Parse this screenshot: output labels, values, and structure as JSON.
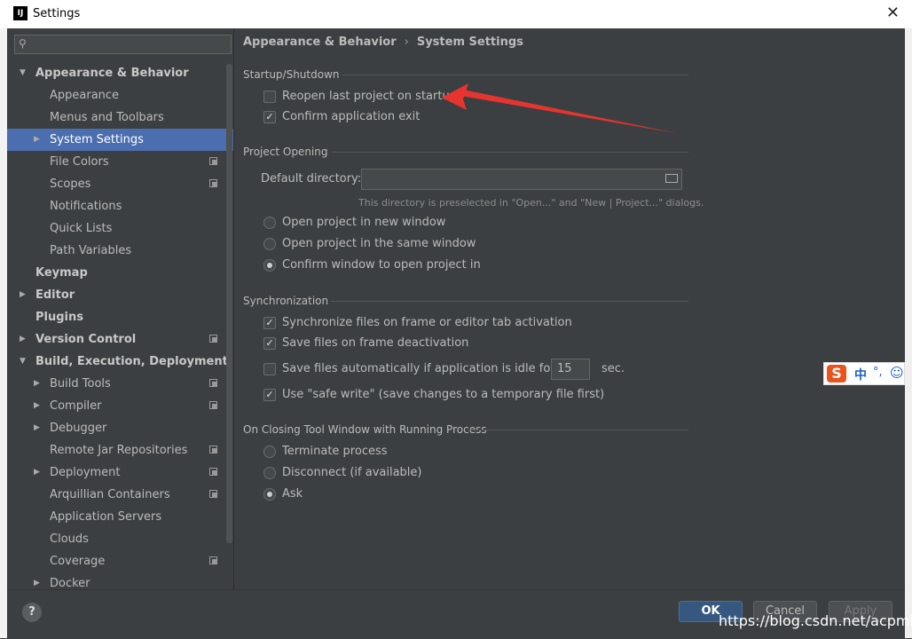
{
  "window": {
    "title": "Settings",
    "app_icon": "IJ"
  },
  "search": {
    "placeholder": ""
  },
  "sidebar": {
    "items": [
      {
        "label": "Appearance & Behavior",
        "level": 0,
        "arrow": "down",
        "bold": true
      },
      {
        "label": "Appearance",
        "level": 1
      },
      {
        "label": "Menus and Toolbars",
        "level": 1
      },
      {
        "label": "System Settings",
        "level": 1,
        "arrow": "right",
        "selected": true
      },
      {
        "label": "File Colors",
        "level": 1,
        "copy": true
      },
      {
        "label": "Scopes",
        "level": 1,
        "copy": true
      },
      {
        "label": "Notifications",
        "level": 1
      },
      {
        "label": "Quick Lists",
        "level": 1
      },
      {
        "label": "Path Variables",
        "level": 1
      },
      {
        "label": "Keymap",
        "level": 0,
        "bold": true
      },
      {
        "label": "Editor",
        "level": 0,
        "arrow": "right",
        "bold": true
      },
      {
        "label": "Plugins",
        "level": 0,
        "bold": true
      },
      {
        "label": "Version Control",
        "level": 0,
        "arrow": "right",
        "bold": true,
        "copy": true
      },
      {
        "label": "Build, Execution, Deployment",
        "level": 0,
        "arrow": "down",
        "bold": true
      },
      {
        "label": "Build Tools",
        "level": 1,
        "arrow": "right",
        "copy": true
      },
      {
        "label": "Compiler",
        "level": 1,
        "arrow": "right",
        "copy": true
      },
      {
        "label": "Debugger",
        "level": 1,
        "arrow": "right"
      },
      {
        "label": "Remote Jar Repositories",
        "level": 1,
        "copy": true
      },
      {
        "label": "Deployment",
        "level": 1,
        "arrow": "right",
        "copy": true
      },
      {
        "label": "Arquillian Containers",
        "level": 1,
        "copy": true
      },
      {
        "label": "Application Servers",
        "level": 1
      },
      {
        "label": "Clouds",
        "level": 1
      },
      {
        "label": "Coverage",
        "level": 1,
        "copy": true
      },
      {
        "label": "Docker",
        "level": 1,
        "arrow": "right"
      }
    ]
  },
  "breadcrumb": {
    "parent": "Appearance & Behavior",
    "sep": "›",
    "current": "System Settings"
  },
  "startup": {
    "title": "Startup/Shutdown",
    "reopen": {
      "label": "Reopen last project on startup",
      "checked": false
    },
    "confirm_exit": {
      "label": "Confirm application exit",
      "checked": true
    }
  },
  "opening": {
    "title": "Project Opening",
    "dir_label": "Default directory:",
    "dir_value": "",
    "hint": "This directory is preselected in \"Open...\" and \"New | Project...\" dialogs.",
    "options": [
      {
        "label": "Open project in new window",
        "selected": false
      },
      {
        "label": "Open project in the same window",
        "selected": false
      },
      {
        "label": "Confirm window to open project in",
        "selected": true
      }
    ]
  },
  "sync": {
    "title": "Synchronization",
    "items": [
      {
        "label": "Synchronize files on frame or editor tab activation",
        "checked": true
      },
      {
        "label": "Save files on frame deactivation",
        "checked": true
      },
      {
        "label": "Save files automatically if application is idle for",
        "checked": false
      },
      {
        "label": "Use \"safe write\" (save changes to a temporary file first)",
        "checked": true
      }
    ],
    "idle_value": "15",
    "idle_unit": "sec."
  },
  "closing": {
    "title": "On Closing Tool Window with Running Process",
    "options": [
      {
        "label": "Terminate process",
        "selected": false
      },
      {
        "label": "Disconnect (if available)",
        "selected": false
      },
      {
        "label": "Ask",
        "selected": true
      }
    ]
  },
  "footer": {
    "help": "?",
    "ok": "OK",
    "cancel": "Cancel",
    "apply": "Apply"
  },
  "watermark": "https://blog.csdn.net/acpmbe",
  "ime": {
    "logo": "S",
    "mode": "中",
    "punct": "°,",
    "face": "☺"
  },
  "colors": {
    "selection": "#4b6eaf",
    "ok_button": "#365880",
    "annotation": "#e8342f"
  }
}
